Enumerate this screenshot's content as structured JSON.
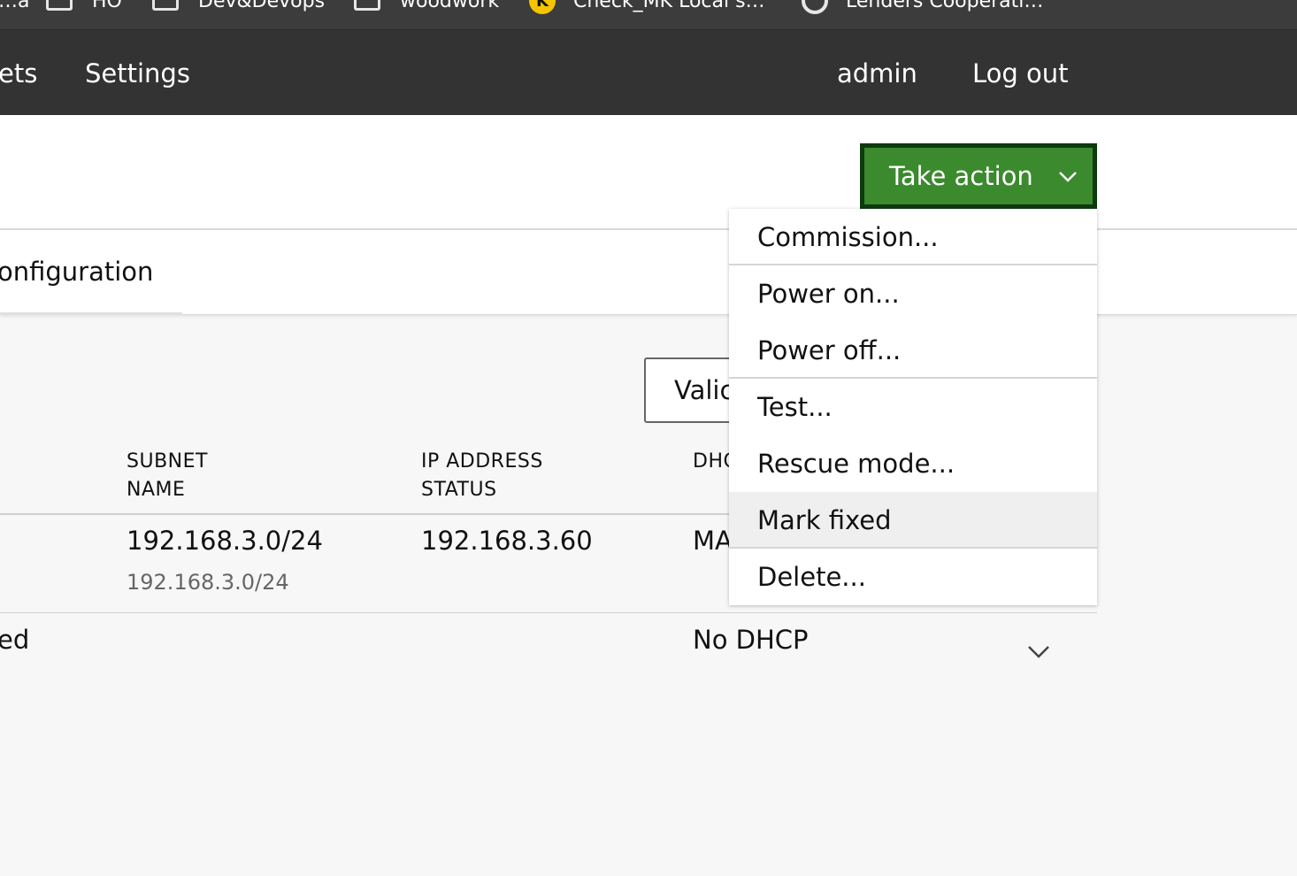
{
  "bookmarks": [
    {
      "label": "…a",
      "icon": "folder-icon"
    },
    {
      "label": "HO",
      "icon": "folder-icon"
    },
    {
      "label": "Dev&Devops",
      "icon": "folder-icon"
    },
    {
      "label": "woodwork",
      "icon": "folder-icon"
    },
    {
      "label": "Check_MK Local s…",
      "icon": "k-logo-icon"
    },
    {
      "label": "Lenders Cooperati…",
      "icon": "circle-logo-icon"
    }
  ],
  "nav": {
    "partial_item": "ets",
    "settings": "Settings",
    "user": "admin",
    "logout": "Log out"
  },
  "header": {
    "tab_partial": "onfiguration",
    "take_action_label": "Take action"
  },
  "content": {
    "validate_partial": "Valic",
    "columns": {
      "subnet_line1": "SUBNET",
      "subnet_line2": "NAME",
      "ip_line1": "IP ADDRESS",
      "ip_line2": "STATUS",
      "dhcp_partial": "DHC"
    },
    "rows": [
      {
        "name": "",
        "subnet": "192.168.3.0/24",
        "subnet_sub": "192.168.3.0/24",
        "ip": "192.168.3.60",
        "dhcp": "MA"
      },
      {
        "name": "ed",
        "subnet": "",
        "subnet_sub": "",
        "ip": "",
        "dhcp": "No DHCP"
      }
    ]
  },
  "dropdown": {
    "items": [
      "Commission...",
      "Power on...",
      "Power off...",
      "Test...",
      "Rescue mode...",
      "Mark fixed",
      "Delete..."
    ],
    "hovered": "Mark fixed"
  },
  "colors": {
    "nav_bg": "#333333",
    "bookmarks_bg": "#3c3c3c",
    "action_green": "#3b8a2e",
    "action_border": "#0e3a0e",
    "page_bg": "#f7f7f7"
  }
}
